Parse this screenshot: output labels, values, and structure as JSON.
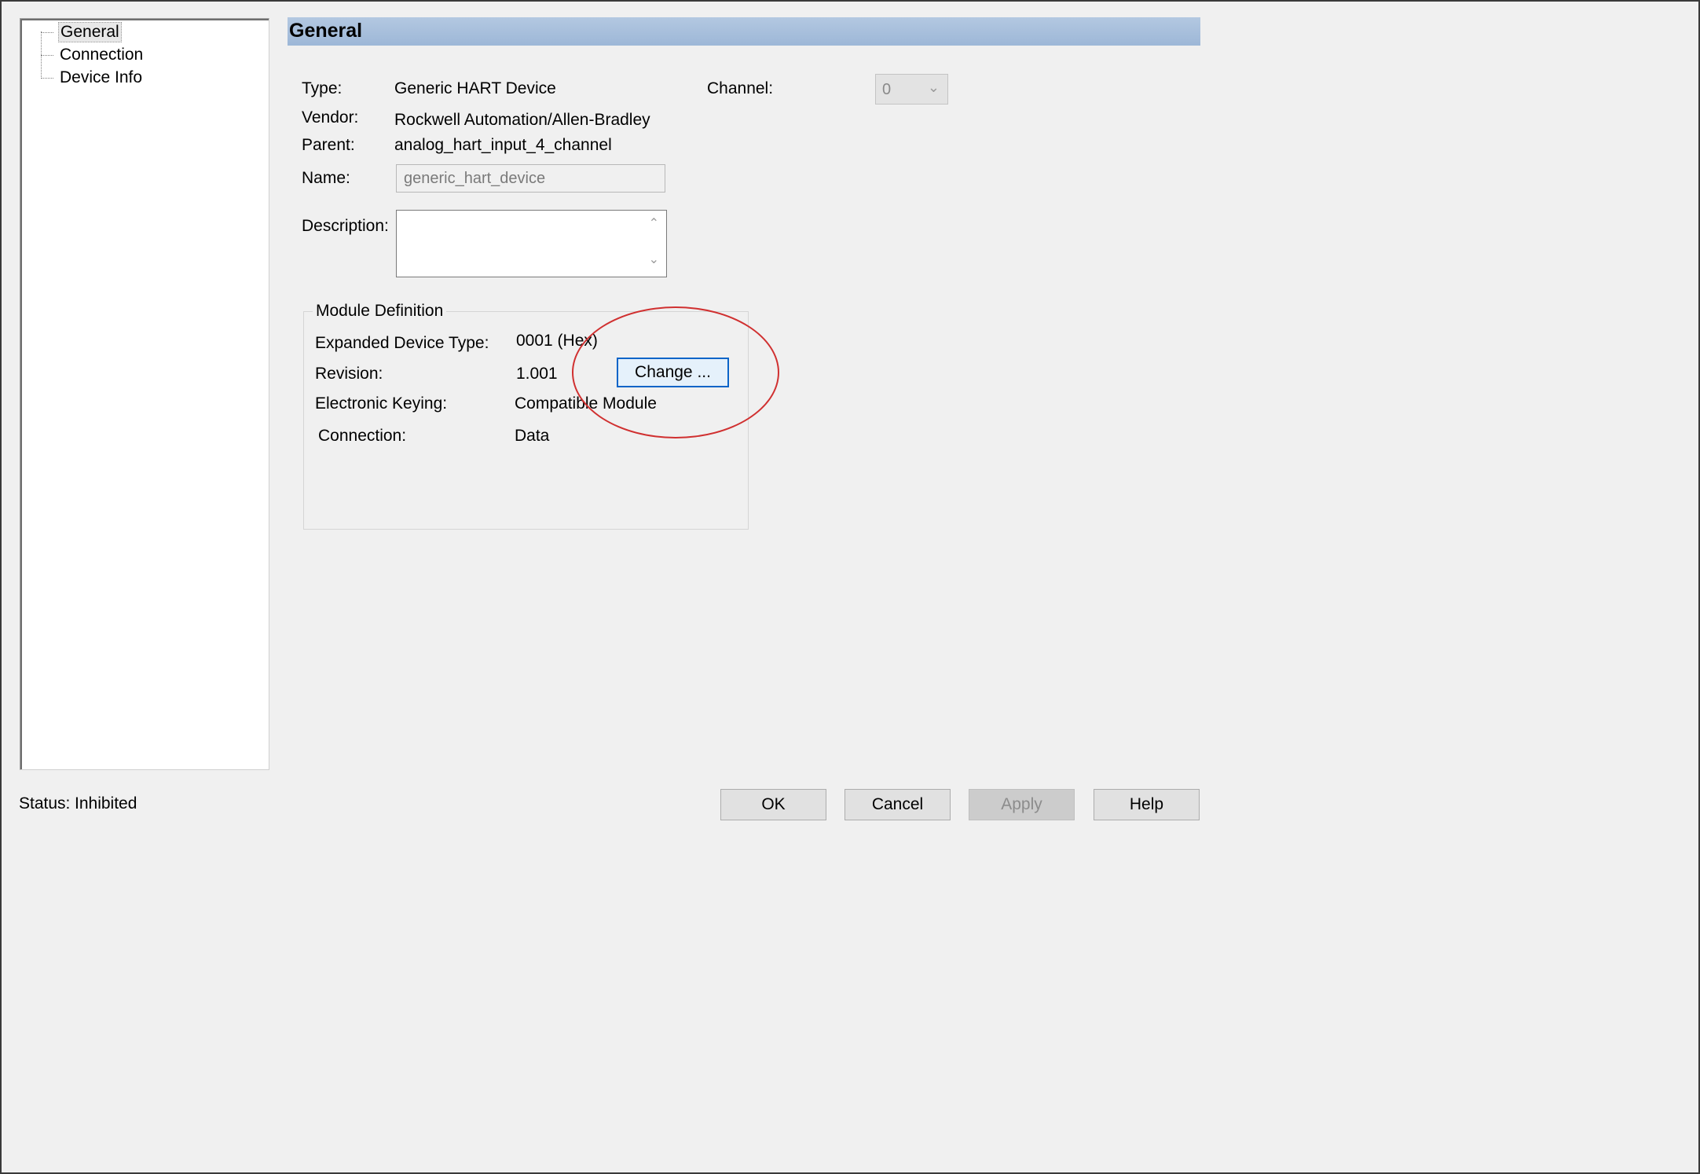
{
  "tree": {
    "items": [
      {
        "label": "General",
        "selected": true
      },
      {
        "label": "Connection",
        "selected": false
      },
      {
        "label": "Device Info",
        "selected": false
      }
    ]
  },
  "header": {
    "title": "General"
  },
  "general": {
    "type_label": "Type:",
    "type_value": "Generic HART Device",
    "vendor_label": "Vendor:",
    "vendor_value": "Rockwell Automation/Allen-Bradley",
    "parent_label": "Parent:",
    "parent_value": "analog_hart_input_4_channel",
    "name_label": "Name:",
    "name_value": "generic_hart_device",
    "description_label": "Description:",
    "description_value": "",
    "channel_label": "Channel:",
    "channel_value": "0"
  },
  "module_definition": {
    "title": "Module Definition",
    "expanded_device_type_label": "Expanded Device Type:",
    "expanded_device_type_value": "0001 (Hex)",
    "revision_label": "Revision:",
    "revision_value": "1.001",
    "change_button": "Change ...",
    "electronic_keying_label": "Electronic Keying:",
    "electronic_keying_value": "Compatible Module",
    "connection_label": "Connection:",
    "connection_value": "Data"
  },
  "status": {
    "label": "Status:",
    "value": "Inhibited"
  },
  "buttons": {
    "ok": "OK",
    "cancel": "Cancel",
    "apply": "Apply",
    "help": "Help"
  },
  "colors": {
    "header_bar": "#a8c0dc",
    "highlight_ring": "#d03030",
    "focus_border": "#0a64c8"
  }
}
